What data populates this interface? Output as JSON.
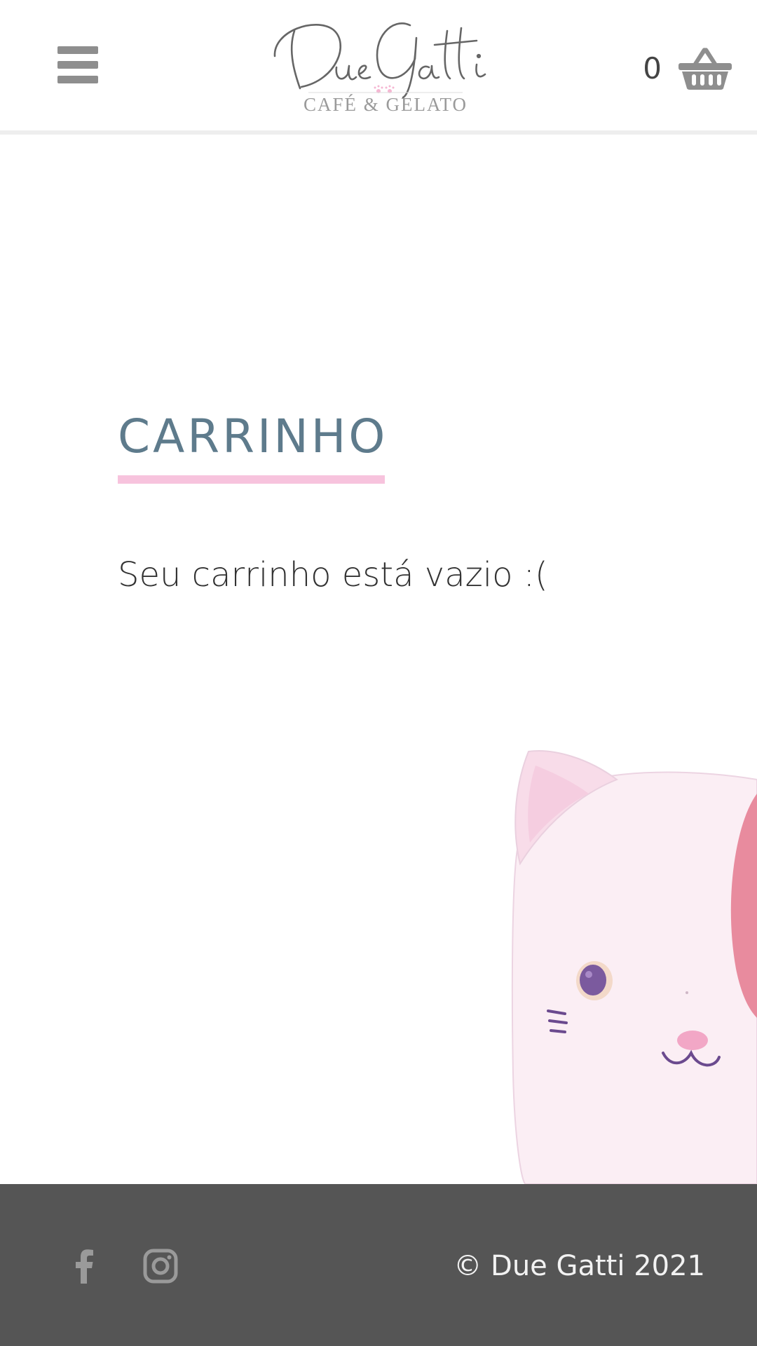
{
  "header": {
    "menu_icon": "hamburger-menu-icon",
    "logo": {
      "script_text": "DueGatti",
      "tagline": "CAFÉ & GELATO"
    },
    "cart": {
      "count": "0",
      "icon": "basket-icon"
    }
  },
  "main": {
    "title": "CARRINHO",
    "empty_message": "Seu carrinho está vazio :(",
    "decoration": "cat-plush-image"
  },
  "footer": {
    "social": [
      {
        "name": "facebook",
        "icon": "facebook-icon"
      },
      {
        "name": "instagram",
        "icon": "instagram-icon"
      }
    ],
    "copyright": "© Due Gatti 2021"
  },
  "colors": {
    "title": "#5e7b8c",
    "underline": "#f7c3dd",
    "footer_bg": "#555555",
    "icon_gray": "#8e8e8e",
    "header_border": "#eeeeee"
  }
}
